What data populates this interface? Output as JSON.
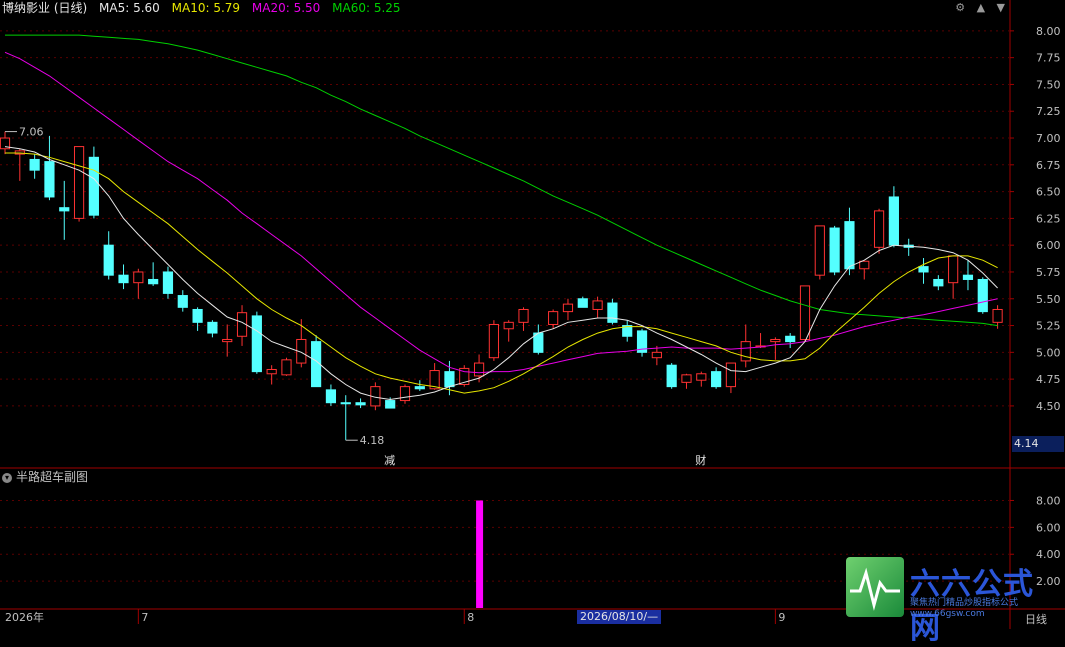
{
  "main_panel": {
    "stock_name": "博纳影业 (日线)",
    "indicators": [
      {
        "label": "MA5: 5.60",
        "color": "#e6e6e6"
      },
      {
        "label": "MA10: 5.79",
        "color": "#e6e600"
      },
      {
        "label": "MA20: 5.50",
        "color": "#e600e6"
      },
      {
        "label": "MA60: 5.25",
        "color": "#00d000"
      }
    ],
    "corner_icons": [
      "gear-icon",
      "up-arrow-icon",
      "down-arrow-icon"
    ],
    "high_label": "7.06",
    "low_label": "4.18",
    "current_price_box": "4.14",
    "event_markers": [
      "减",
      "财"
    ]
  },
  "sub_panel": {
    "title": "半路超车副图",
    "y_ticks": [
      "8.00",
      "6.00",
      "4.00",
      "2.00"
    ]
  },
  "x_axis": {
    "labels": [
      "2026年",
      "7",
      "8",
      "9"
    ],
    "cursor_date": "2026/08/10/—",
    "period": "日线"
  },
  "watermark": {
    "title": "六六公式网",
    "subtitle": "聚焦热门精品炒股指标公式",
    "url": "www.66gsw.com"
  },
  "chart_data": [
    {
      "type": "candlestick",
      "y_ticks": [
        8.0,
        7.75,
        7.5,
        7.25,
        7.0,
        6.75,
        6.5,
        6.25,
        6.0,
        5.75,
        5.5,
        5.25,
        5.0,
        4.75,
        4.5
      ],
      "ylim": [
        4.07,
        8.12
      ],
      "candles": [
        [
          6.9,
          7.06,
          6.85,
          7.0
        ],
        [
          6.85,
          6.9,
          6.6,
          6.88
        ],
        [
          6.8,
          6.85,
          6.62,
          6.7
        ],
        [
          6.78,
          7.02,
          6.42,
          6.45
        ],
        [
          6.35,
          6.6,
          6.05,
          6.32
        ],
        [
          6.25,
          6.92,
          6.22,
          6.92
        ],
        [
          6.82,
          6.92,
          6.25,
          6.28
        ],
        [
          6.0,
          6.13,
          5.68,
          5.72
        ],
        [
          5.72,
          5.82,
          5.59,
          5.65
        ],
        [
          5.65,
          5.78,
          5.5,
          5.75
        ],
        [
          5.68,
          5.84,
          5.62,
          5.64
        ],
        [
          5.75,
          5.8,
          5.5,
          5.55
        ],
        [
          5.53,
          5.58,
          5.38,
          5.42
        ],
        [
          5.4,
          5.42,
          5.2,
          5.28
        ],
        [
          5.28,
          5.3,
          5.14,
          5.18
        ],
        [
          5.1,
          5.26,
          4.96,
          5.12
        ],
        [
          5.15,
          5.44,
          5.06,
          5.37
        ],
        [
          5.34,
          5.38,
          4.8,
          4.82
        ],
        [
          4.8,
          4.88,
          4.7,
          4.84
        ],
        [
          4.79,
          4.95,
          4.78,
          4.93
        ],
        [
          4.9,
          5.31,
          4.86,
          5.12
        ],
        [
          5.1,
          5.16,
          4.68,
          4.68
        ],
        [
          4.65,
          4.7,
          4.5,
          4.53
        ],
        [
          4.53,
          4.6,
          4.18,
          4.52
        ],
        [
          4.53,
          4.57,
          4.48,
          4.51
        ],
        [
          4.5,
          4.72,
          4.46,
          4.68
        ],
        [
          4.55,
          4.58,
          4.48,
          4.48
        ],
        [
          4.55,
          4.7,
          4.52,
          4.68
        ],
        [
          4.68,
          4.74,
          4.64,
          4.66
        ],
        [
          4.66,
          4.9,
          4.65,
          4.83
        ],
        [
          4.82,
          4.92,
          4.6,
          4.68
        ],
        [
          4.7,
          4.88,
          4.68,
          4.85
        ],
        [
          4.78,
          4.98,
          4.72,
          4.9
        ],
        [
          4.95,
          5.3,
          4.92,
          5.26
        ],
        [
          5.22,
          5.3,
          5.1,
          5.28
        ],
        [
          5.28,
          5.42,
          5.2,
          5.4
        ],
        [
          5.18,
          5.26,
          4.98,
          5.0
        ],
        [
          5.26,
          5.4,
          5.22,
          5.38
        ],
        [
          5.38,
          5.5,
          5.3,
          5.45
        ],
        [
          5.5,
          5.52,
          5.42,
          5.42
        ],
        [
          5.4,
          5.52,
          5.32,
          5.48
        ],
        [
          5.46,
          5.5,
          5.26,
          5.28
        ],
        [
          5.25,
          5.3,
          5.1,
          5.15
        ],
        [
          5.2,
          5.22,
          4.96,
          5.0
        ],
        [
          4.95,
          5.06,
          4.88,
          5.0
        ],
        [
          4.88,
          4.9,
          4.66,
          4.68
        ],
        [
          4.72,
          4.8,
          4.66,
          4.79
        ],
        [
          4.74,
          4.82,
          4.68,
          4.8
        ],
        [
          4.82,
          4.86,
          4.66,
          4.68
        ],
        [
          4.68,
          4.9,
          4.62,
          4.9
        ],
        [
          4.92,
          5.26,
          4.86,
          5.1
        ],
        [
          5.05,
          5.18,
          5.04,
          5.06
        ],
        [
          5.1,
          5.14,
          4.93,
          5.12
        ],
        [
          5.15,
          5.18,
          5.04,
          5.1
        ],
        [
          5.12,
          5.62,
          5.1,
          5.62
        ],
        [
          5.72,
          6.16,
          5.68,
          6.18
        ],
        [
          6.16,
          6.18,
          5.72,
          5.75
        ],
        [
          6.22,
          6.35,
          5.72,
          5.78
        ],
        [
          5.78,
          5.85,
          5.68,
          5.85
        ],
        [
          5.98,
          6.34,
          5.92,
          6.32
        ],
        [
          6.45,
          6.55,
          5.98,
          6.0
        ],
        [
          6.0,
          6.06,
          5.9,
          5.98
        ],
        [
          5.8,
          5.88,
          5.64,
          5.75
        ],
        [
          5.68,
          5.72,
          5.58,
          5.62
        ],
        [
          5.65,
          5.9,
          5.5,
          5.9
        ],
        [
          5.72,
          5.86,
          5.58,
          5.68
        ],
        [
          5.68,
          5.7,
          5.36,
          5.38
        ],
        [
          5.28,
          5.44,
          5.22,
          5.4
        ]
      ],
      "ma5": [
        6.92,
        6.9,
        6.87,
        6.8,
        6.75,
        6.7,
        6.62,
        6.46,
        6.25,
        6.1,
        5.96,
        5.82,
        5.68,
        5.55,
        5.44,
        5.33,
        5.28,
        5.2,
        5.1,
        5.05,
        5.0,
        4.92,
        4.8,
        4.7,
        4.62,
        4.58,
        4.56,
        4.58,
        4.6,
        4.63,
        4.68,
        4.72,
        4.76,
        4.84,
        4.95,
        5.08,
        5.18,
        5.22,
        5.28,
        5.3,
        5.32,
        5.32,
        5.3,
        5.25,
        5.18,
        5.12,
        5.05,
        4.98,
        4.9,
        4.83,
        4.82,
        4.86,
        4.9,
        4.95,
        5.1,
        5.4,
        5.62,
        5.8,
        5.86,
        5.95,
        6.0,
        5.99,
        5.98,
        5.96,
        5.93,
        5.86,
        5.74,
        5.6
      ],
      "ma10": [
        6.86,
        6.86,
        6.85,
        6.82,
        6.78,
        6.74,
        6.7,
        6.62,
        6.5,
        6.4,
        6.3,
        6.2,
        6.08,
        5.96,
        5.85,
        5.74,
        5.62,
        5.5,
        5.4,
        5.32,
        5.25,
        5.15,
        5.05,
        4.95,
        4.87,
        4.8,
        4.76,
        4.73,
        4.7,
        4.68,
        4.65,
        4.62,
        4.64,
        4.67,
        4.73,
        4.8,
        4.88,
        4.96,
        5.05,
        5.12,
        5.18,
        5.22,
        5.24,
        5.24,
        5.22,
        5.18,
        5.14,
        5.1,
        5.06,
        5.0,
        4.96,
        4.93,
        4.92,
        4.92,
        4.94,
        5.04,
        5.18,
        5.3,
        5.42,
        5.55,
        5.66,
        5.75,
        5.82,
        5.88,
        5.9,
        5.9,
        5.86,
        5.79
      ],
      "ma20": [
        7.8,
        7.74,
        7.66,
        7.58,
        7.48,
        7.38,
        7.28,
        7.18,
        7.08,
        6.98,
        6.88,
        6.78,
        6.7,
        6.62,
        6.52,
        6.42,
        6.3,
        6.2,
        6.1,
        6.0,
        5.9,
        5.78,
        5.66,
        5.54,
        5.42,
        5.32,
        5.22,
        5.12,
        5.02,
        4.94,
        4.86,
        4.82,
        4.81,
        4.82,
        4.82,
        4.84,
        4.87,
        4.9,
        4.93,
        4.96,
        4.99,
        5.0,
        5.01,
        5.03,
        5.04,
        5.05,
        5.04,
        5.04,
        5.04,
        5.03,
        5.04,
        5.05,
        5.07,
        5.08,
        5.1,
        5.13,
        5.16,
        5.2,
        5.24,
        5.27,
        5.3,
        5.33,
        5.35,
        5.38,
        5.41,
        5.44,
        5.47,
        5.5
      ],
      "ma60": [
        7.96,
        7.96,
        7.96,
        7.96,
        7.96,
        7.96,
        7.95,
        7.94,
        7.93,
        7.92,
        7.9,
        7.88,
        7.85,
        7.82,
        7.78,
        7.74,
        7.7,
        7.66,
        7.62,
        7.58,
        7.52,
        7.47,
        7.4,
        7.34,
        7.27,
        7.21,
        7.15,
        7.09,
        7.02,
        6.96,
        6.9,
        6.84,
        6.78,
        6.72,
        6.66,
        6.6,
        6.53,
        6.46,
        6.4,
        6.34,
        6.28,
        6.21,
        6.14,
        6.07,
        6.0,
        5.94,
        5.88,
        5.82,
        5.76,
        5.7,
        5.64,
        5.58,
        5.53,
        5.48,
        5.44,
        5.4,
        5.38,
        5.36,
        5.35,
        5.34,
        5.33,
        5.32,
        5.31,
        5.3,
        5.29,
        5.28,
        5.27,
        5.25
      ]
    },
    {
      "type": "bar",
      "title": "半路超车副图",
      "y_ticks": [
        8.0,
        6.0,
        4.0,
        2.0
      ],
      "ylim": [
        0,
        9.3
      ],
      "bars": [
        {
          "index": 32,
          "value": 8.0,
          "color": "#ff00ff"
        }
      ]
    }
  ]
}
